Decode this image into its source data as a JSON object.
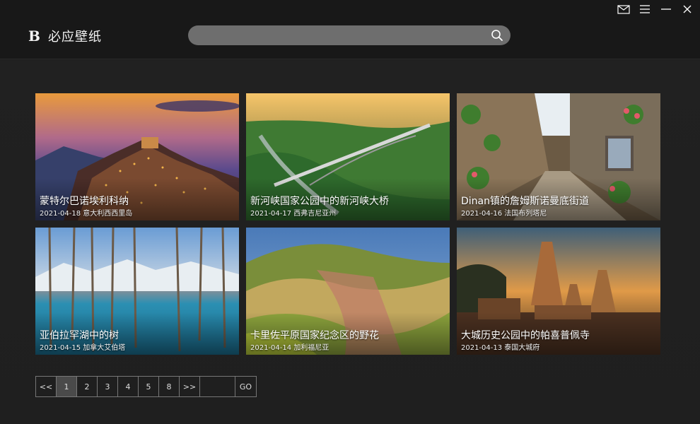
{
  "app": {
    "logo_mark": "B",
    "name": "必应壁纸"
  },
  "search": {
    "value": "",
    "placeholder": ""
  },
  "window_controls": {
    "icons": [
      "mail-icon",
      "menu-icon",
      "minimize-icon",
      "close-icon"
    ]
  },
  "cards": [
    {
      "title": "蒙特尔巴诺埃利科纳",
      "meta": "2021-04-18 意大利西西里岛"
    },
    {
      "title": "新河峡国家公园中的新河峡大桥",
      "meta": "2021-04-17 西弗吉尼亚州"
    },
    {
      "title": "Dinan镇的詹姆斯诺曼底街道",
      "meta": "2021-04-16 法国布列塔尼"
    },
    {
      "title": "亚伯拉罕湖中的树",
      "meta": "2021-04-15 加拿大艾伯塔"
    },
    {
      "title": "卡里佐平原国家纪念区的野花",
      "meta": "2021-04-14 加利福尼亚"
    },
    {
      "title": "大城历史公园中的帕喜普佩寺",
      "meta": "2021-04-13 泰国大城府"
    }
  ],
  "pager": {
    "first": "<<",
    "pages": [
      "1",
      "2",
      "3",
      "4",
      "5",
      "8"
    ],
    "next": ">>",
    "goto_value": "",
    "go": "GO",
    "current": "1"
  },
  "colors": {
    "background": "#1e1e1e",
    "header": "#181818",
    "search": "#6e6e6e",
    "active_page": "#4a4a4a"
  }
}
